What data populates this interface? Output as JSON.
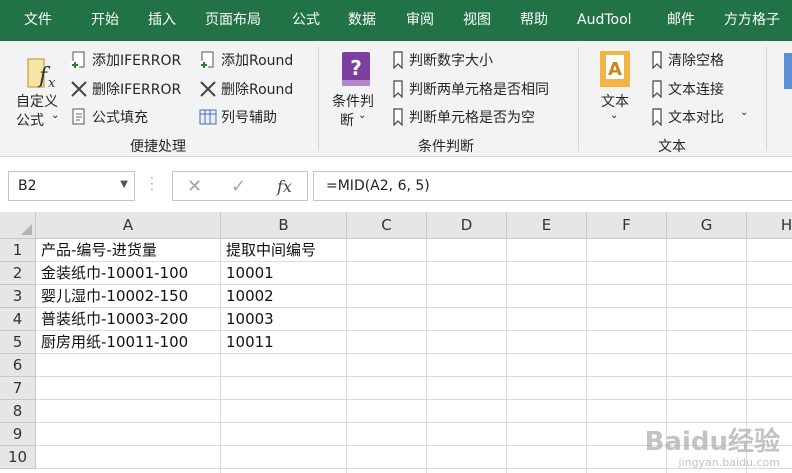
{
  "tabs": [
    "文件",
    "开始",
    "插入",
    "页面布局",
    "公式",
    "数据",
    "审阅",
    "视图",
    "帮助",
    "AudTool",
    "邮件",
    "方方格子"
  ],
  "ribbon": {
    "custom_formula_label_line1": "自定义",
    "custom_formula_label_line2": "公式",
    "add_iferror": "添加IFERROR",
    "remove_iferror": "删除IFERROR",
    "formula_fill": "公式填充",
    "add_round": "添加Round",
    "remove_round": "删除Round",
    "column_helper": "列号辅助",
    "group1_label": "便捷处理",
    "cond_judge_line1": "条件判",
    "cond_judge_line2": "断",
    "judge_number_size": "判断数字大小",
    "judge_two_cells_same": "判断两单元格是否相同",
    "judge_cell_empty": "判断单元格是否为空",
    "group2_label": "条件判断",
    "text_label": "文本",
    "clear_spaces": "清除空格",
    "text_join": "文本连接",
    "text_compare": "文本对比",
    "group3_label": "文本"
  },
  "formula_bar": {
    "name_box": "B2",
    "formula": "=MID(A2, 6, 5)",
    "fx_symbol": "fx",
    "cancel_symbol": "✕",
    "enter_symbol": "✓"
  },
  "sheet": {
    "columns": [
      "A",
      "B",
      "C",
      "D",
      "E",
      "F",
      "G",
      "H"
    ],
    "rows": [
      "1",
      "2",
      "3",
      "4",
      "5",
      "6",
      "7",
      "8",
      "9",
      "10"
    ],
    "cells": [
      [
        "产品-编号-进货量",
        "提取中间编号"
      ],
      [
        "金装纸巾-10001-100",
        "10001"
      ],
      [
        "婴儿湿巾-10002-150",
        "10002"
      ],
      [
        "普装纸巾-10003-200",
        "10003"
      ],
      [
        "厨房用纸-10011-100",
        "10011"
      ]
    ]
  },
  "watermark": {
    "brand": "Baidu经验",
    "url": "jingyan.baidu.com"
  }
}
